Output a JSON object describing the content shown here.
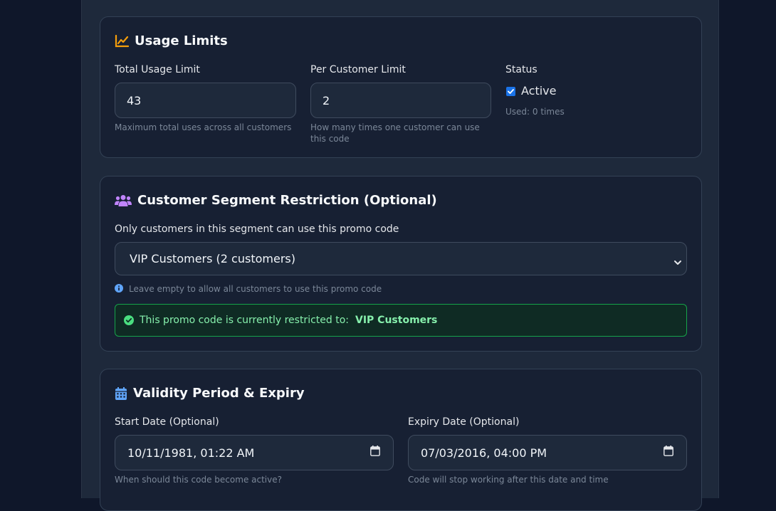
{
  "usage": {
    "title": "Usage Limits",
    "total_label": "Total Usage Limit",
    "total_value": "43",
    "total_help": "Maximum total uses across all customers",
    "per_customer_label": "Per Customer Limit",
    "per_customer_value": "2",
    "per_customer_help_line1": "How many times one customer can use",
    "per_customer_help_line2": "this code",
    "status_label": "Status",
    "active_label": "Active",
    "active_checked": true,
    "used_text": "Used: 0 times"
  },
  "segment": {
    "title": "Customer Segment Restriction (Optional)",
    "description": "Only customers in this segment can use this promo code",
    "selected": "VIP Customers (2 customers)",
    "help": "Leave empty to allow all customers to use this promo code",
    "restricted_text": "This promo code is currently restricted to:",
    "restricted_segment": "VIP Customers"
  },
  "validity": {
    "title": "Validity Period & Expiry",
    "start_label": "Start Date (Optional)",
    "start_value": "10/11/1981, 01:22 AM",
    "start_help": "When should this code become active?",
    "expiry_label": "Expiry Date (Optional)",
    "expiry_value": "07/03/2016, 04:00 PM",
    "expiry_help": "Code will stop working after this date and time"
  },
  "colors": {
    "usage_icon": "#f59e0b",
    "segment_icon": "#c084fc",
    "validity_icon": "#60a5fa",
    "success": "#4ade80",
    "checkbox": "#1a73e8"
  },
  "icons": {
    "usage": "chart-line-icon",
    "segment": "users-icon",
    "validity": "calendar-icon",
    "info": "info-icon",
    "check": "check-circle-icon"
  }
}
